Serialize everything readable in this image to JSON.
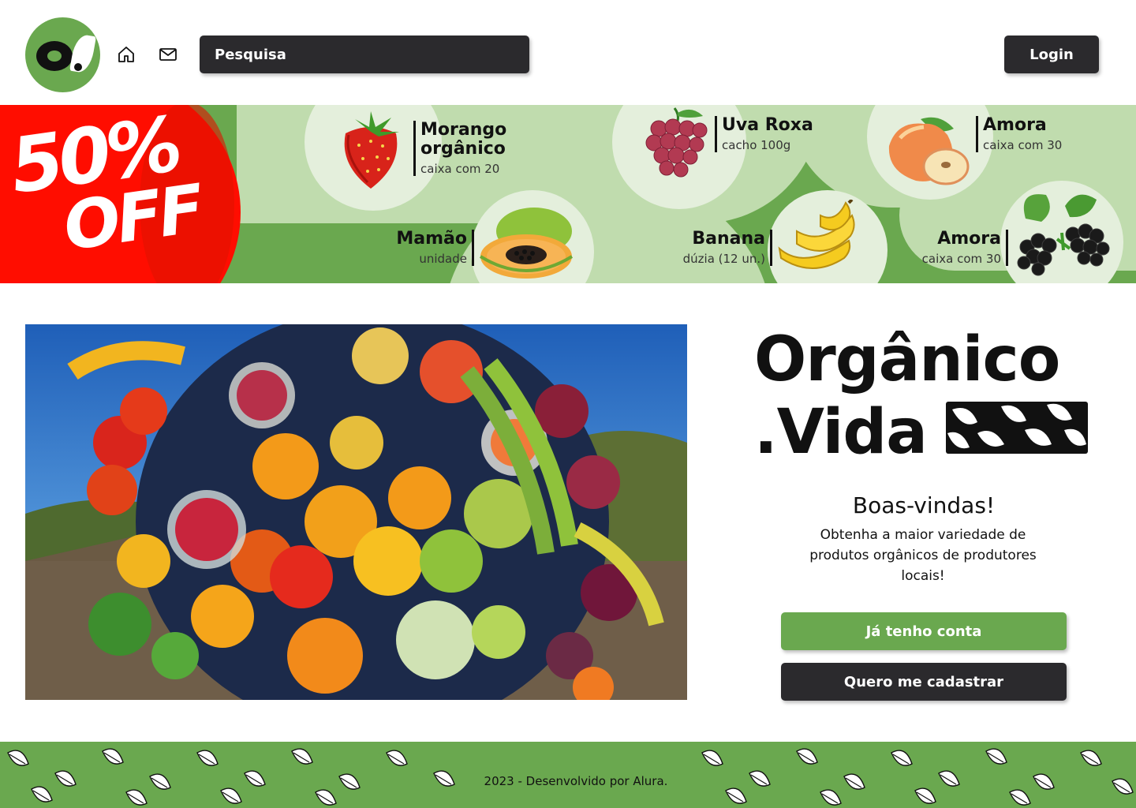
{
  "header": {
    "logo_alt": "Orgânico.Vida",
    "search_placeholder": "Pesquisa",
    "login_label": "Login",
    "icons": [
      "home-icon",
      "mail-icon"
    ]
  },
  "promo": {
    "badge_percent": "50%",
    "badge_word": "OFF",
    "products": [
      {
        "name_line1": "Morango",
        "name_line2": "orgânico",
        "desc": "caixa com 20",
        "icon": "strawberry-icon"
      },
      {
        "name": "Uva Roxa",
        "desc": "cacho 100g",
        "icon": "grape-icon"
      },
      {
        "name": "Amora",
        "desc": "caixa com 30",
        "icon": "apple-icon"
      },
      {
        "name": "Mamão",
        "desc": "unidade",
        "icon": "papaya-icon"
      },
      {
        "name": "Banana",
        "desc": "dúzia (12 un.)",
        "icon": "banana-icon"
      },
      {
        "name": "Amora",
        "desc": "caixa com 30",
        "icon": "blackberry-icon"
      }
    ]
  },
  "hero": {
    "image": "fruit-basket-photo",
    "brand_line1": "Orgânico",
    "brand_line2": ".Vida",
    "welcome": "Boas-vindas!",
    "subtitle": "Obtenha a maior variedade de produtos orgânicos de produtores locais!",
    "primary_button": "Já tenho conta",
    "secondary_button": "Quero me cadastrar"
  },
  "footer": {
    "text": "2023 - Desenvolvido por Alura."
  },
  "colors": {
    "brand_green": "#6aa84f",
    "light_green": "#c0dcae",
    "dark": "#2b2a2d",
    "promo_red": "#ff0d00"
  }
}
